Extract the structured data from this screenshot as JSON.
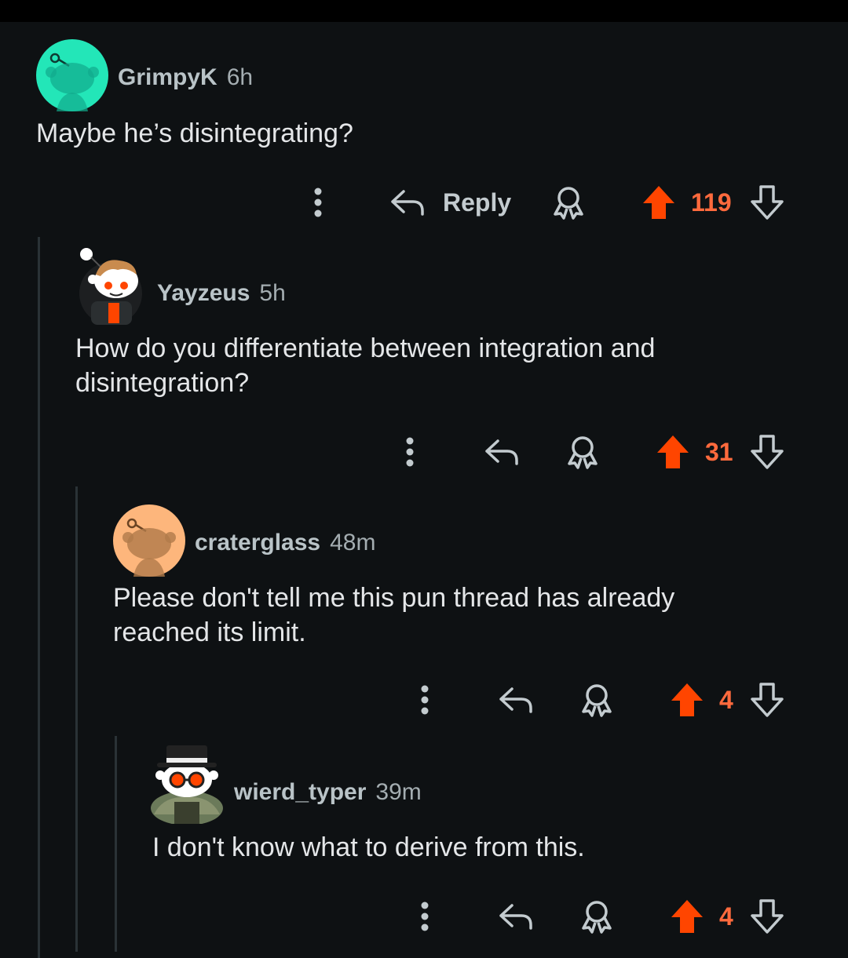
{
  "colors": {
    "background": "#0e1113",
    "upvote_active": "#ff4500",
    "score": "#ff6a3d",
    "thread_line": "#2a3236"
  },
  "comments": [
    {
      "username": "GrimpyK",
      "time": "6h",
      "body": "Maybe he’s disintegrating?",
      "reply_label": "Reply",
      "score": "119",
      "avatar": "snoo-teal-avatar"
    },
    {
      "username": "Yayzeus",
      "time": "5h",
      "body": "How do you differentiate between integration and disintegration?",
      "score": "31",
      "avatar": "snoo-custom-avatar-brown-hair"
    },
    {
      "username": "craterglass",
      "time": "48m",
      "body": "Please don't tell me this pun thread has already reached its limit.",
      "score": "4",
      "avatar": "snoo-orange-avatar"
    },
    {
      "username": "wierd_typer",
      "time": "39m",
      "body": "I don't know what to derive from this.",
      "score": "4",
      "avatar": "snoo-custom-avatar-top-hat"
    }
  ],
  "icons": {
    "more": "more-vertical-icon",
    "reply": "reply-arrow-icon",
    "award": "award-icon",
    "upvote": "upvote-icon",
    "downvote": "downvote-icon"
  }
}
